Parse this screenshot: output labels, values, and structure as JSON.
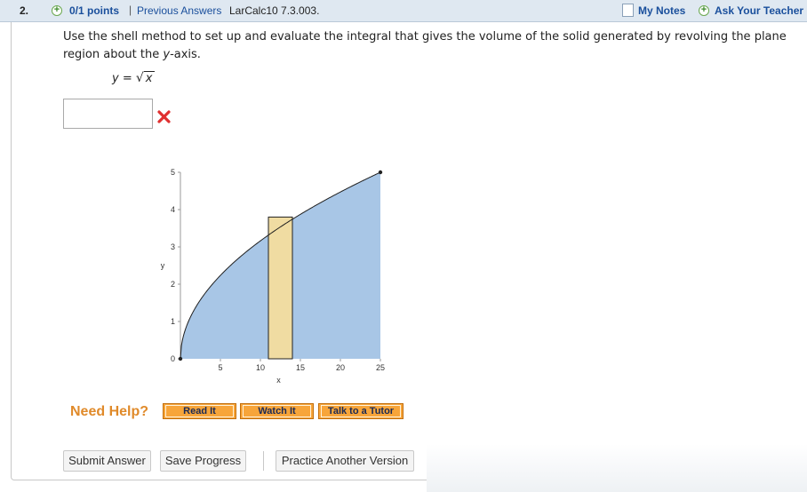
{
  "header": {
    "question_number": "2.",
    "points": "0/1 points",
    "separator": "|",
    "previous_answers": "Previous Answers",
    "question_id": "LarCalc10 7.3.003.",
    "my_notes": "My Notes",
    "ask_teacher": "Ask Your Teacher"
  },
  "question": {
    "prompt_before": "Use the shell method to set up and evaluate the integral that gives the volume of the solid generated by revolving the plane region about the ",
    "prompt_axis_var": "y",
    "prompt_after": "-axis.",
    "equation_lhs": "y",
    "equation_eq": " = ",
    "equation_rad": "x"
  },
  "answer": {
    "value": "",
    "status": "incorrect"
  },
  "chart_data": {
    "type": "area",
    "function": "y = sqrt(x)",
    "x": [
      0,
      1,
      2,
      3,
      4,
      5,
      6,
      7,
      8,
      9,
      10,
      11,
      12,
      13,
      14,
      15,
      16,
      17,
      18,
      19,
      20,
      21,
      22,
      23,
      24,
      25
    ],
    "y": [
      0,
      1,
      1.414,
      1.732,
      2,
      2.236,
      2.449,
      2.646,
      2.828,
      3,
      3.162,
      3.317,
      3.464,
      3.606,
      3.742,
      3.873,
      4,
      4.123,
      4.243,
      4.359,
      4.472,
      4.583,
      4.69,
      4.796,
      4.899,
      5
    ],
    "shell_rect": {
      "x_from": 11,
      "x_to": 14,
      "height": 3.8
    },
    "xlabel": "x",
    "ylabel": "y",
    "xlim": [
      0,
      25
    ],
    "ylim": [
      0,
      5
    ],
    "xticks": [
      "5",
      "10",
      "15",
      "20",
      "25"
    ],
    "yticks": [
      "0",
      "1",
      "2",
      "3",
      "4",
      "5"
    ],
    "grid": false,
    "colors": {
      "region": "#a8c6e6",
      "shell": "#f0dca2",
      "curve": "#1f1f1f"
    }
  },
  "help": {
    "label": "Need Help?",
    "read_it": "Read It",
    "watch_it": "Watch It",
    "talk_to_tutor": "Talk to a Tutor"
  },
  "actions": {
    "submit": "Submit Answer",
    "save": "Save Progress",
    "practice": "Practice Another Version"
  },
  "icons": {
    "points": "plus-circle-icon",
    "notes": "note-icon",
    "ask": "plus-circle-icon",
    "incorrect": "red-x-icon"
  }
}
